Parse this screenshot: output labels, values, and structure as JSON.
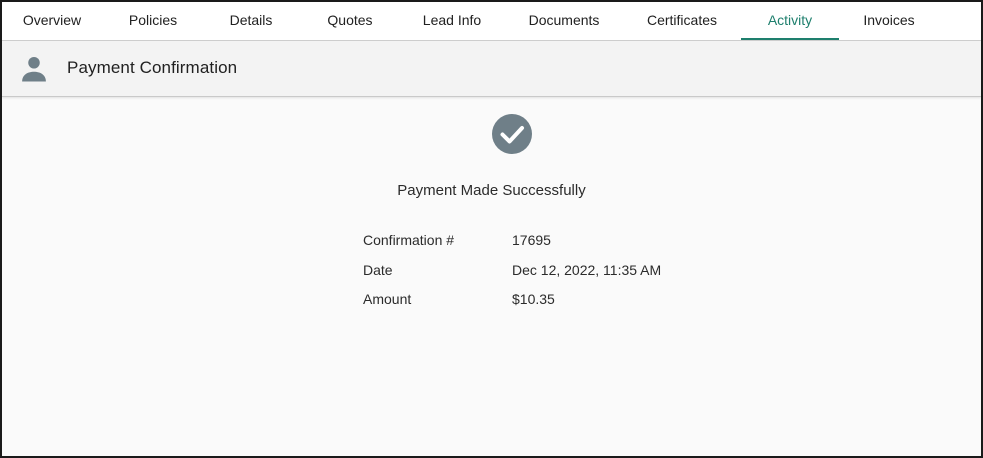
{
  "tabs": [
    {
      "label": "Overview"
    },
    {
      "label": "Policies"
    },
    {
      "label": "Details"
    },
    {
      "label": "Quotes"
    },
    {
      "label": "Lead Info"
    },
    {
      "label": "Documents"
    },
    {
      "label": "Certificates"
    },
    {
      "label": "Activity",
      "active": true
    },
    {
      "label": "Invoices"
    }
  ],
  "header": {
    "icon": "person-icon",
    "title": "Payment Confirmation"
  },
  "confirmation": {
    "icon": "check-circle-icon",
    "message": "Payment Made Successfully",
    "details": [
      {
        "label": "Confirmation #",
        "value": "17695"
      },
      {
        "label": "Date",
        "value": "Dec 12, 2022, 11:35 AM"
      },
      {
        "label": "Amount",
        "value": "$10.35"
      }
    ]
  },
  "colors": {
    "accent": "#1e7f6d",
    "icon_gray": "#6f7f88",
    "text": "#212121"
  }
}
